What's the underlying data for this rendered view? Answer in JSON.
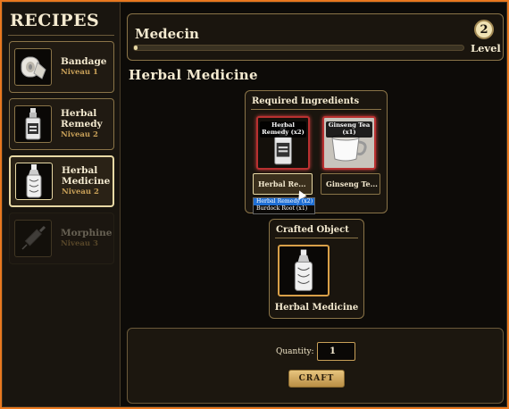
{
  "sidebar": {
    "title": "RECIPES",
    "items": [
      {
        "name": "Bandage",
        "level": "Niveau 1",
        "icon": "bandage-icon"
      },
      {
        "name": "Herbal Remedy",
        "level": "Niveau 2",
        "icon": "bottle-icon"
      },
      {
        "name": "Herbal Medicine",
        "level": "Niveau 2",
        "icon": "medicine-bottle-icon",
        "active": true
      },
      {
        "name": "Morphine",
        "level": "Niveau 3",
        "icon": "syringe-icon",
        "locked": true
      }
    ]
  },
  "profession": {
    "name": "Medecin",
    "level": "2",
    "level_label": "Level",
    "xp_fraction": 0.012
  },
  "recipe_title": "Herbal Medicine",
  "ingredients": {
    "heading": "Required Ingredients",
    "slots": [
      {
        "label": "Herbal Remedy (x2)",
        "icon": "bottle-icon",
        "select_value": "Herbal Re..."
      },
      {
        "label": "Ginseng Tea (x1)",
        "icon": "teacup-icon",
        "select_value": "Ginseng Te..."
      }
    ],
    "dropdown_options": [
      "Herbal Remedy (x2)",
      "Burdock Root (x1)"
    ]
  },
  "crafted": {
    "heading": "Crafted Object",
    "name": "Herbal Medicine",
    "icon": "medicine-bottle-icon"
  },
  "footer": {
    "quantity_label": "Quantity:",
    "quantity_value": "1",
    "craft_label": "CRAFT"
  },
  "colors": {
    "accent_gold": "#c8a058",
    "border": "#8a7448",
    "missing_red": "#b93030",
    "outer": "#e9781f"
  }
}
